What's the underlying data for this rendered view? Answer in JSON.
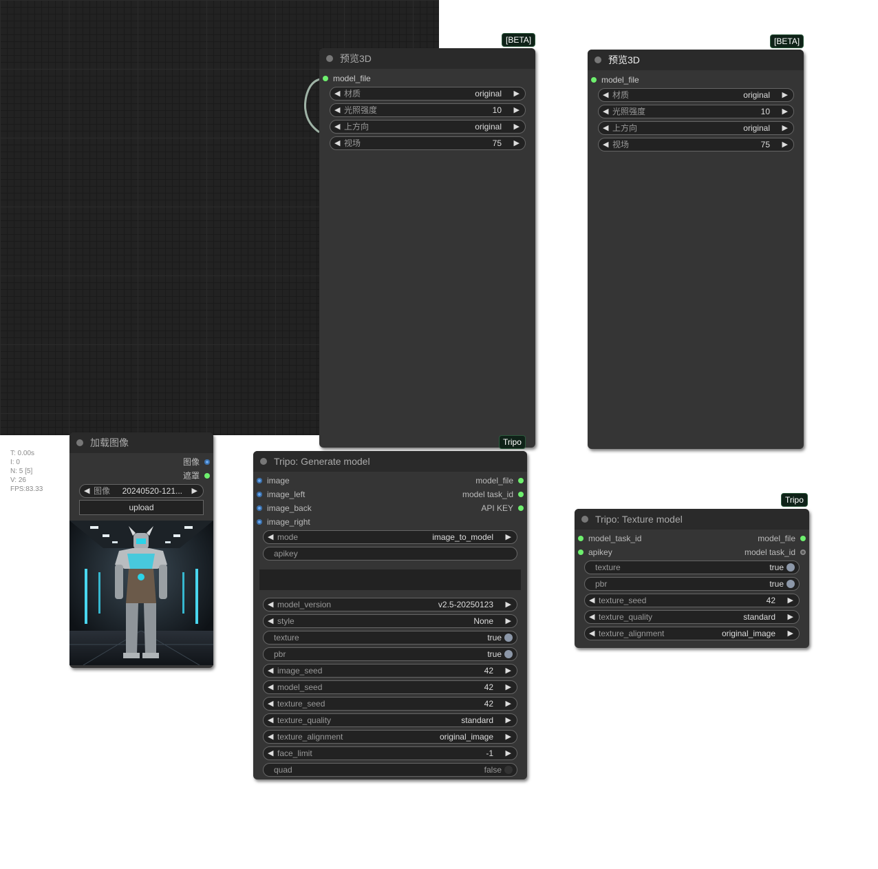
{
  "stats": {
    "t": "T: 0.00s",
    "i": "I: 0",
    "n": "N: 5 [5]",
    "v": "V: 26",
    "fps": "FPS:83.33"
  },
  "preview1": {
    "badge": "[BETA]",
    "footer_badge": "Tripo",
    "title": "预览3D",
    "input": "model_file",
    "widgets": [
      {
        "label": "材质",
        "value": "original"
      },
      {
        "label": "光照强度",
        "value": "10"
      },
      {
        "label": "上方向",
        "value": "original"
      },
      {
        "label": "视场",
        "value": "75"
      }
    ]
  },
  "preview2": {
    "badge": "[BETA]",
    "title": "预览3D",
    "input": "model_file",
    "widgets": [
      {
        "label": "材质",
        "value": "original"
      },
      {
        "label": "光照强度",
        "value": "10"
      },
      {
        "label": "上方向",
        "value": "original"
      },
      {
        "label": "视场",
        "value": "75"
      }
    ]
  },
  "loadimage": {
    "title": "加载图像",
    "out_image": "图像",
    "out_mask": "遮罩",
    "image_label": "图像",
    "image_value": "20240520-121...",
    "upload": "upload"
  },
  "generate": {
    "title": "Tripo: Generate model",
    "inputs": [
      "image",
      "image_left",
      "image_back",
      "image_right"
    ],
    "outputs": [
      "model_file",
      "model task_id",
      "API KEY"
    ],
    "mode": {
      "label": "mode",
      "value": "image_to_model"
    },
    "apikey": "apikey",
    "widgets": [
      {
        "label": "model_version",
        "value": "v2.5-20250123"
      },
      {
        "label": "style",
        "value": "None"
      }
    ],
    "texture": {
      "label": "texture",
      "value": "true"
    },
    "pbr": {
      "label": "pbr",
      "value": "true"
    },
    "widgets2": [
      {
        "label": "image_seed",
        "value": "42"
      },
      {
        "label": "model_seed",
        "value": "42"
      },
      {
        "label": "texture_seed",
        "value": "42"
      },
      {
        "label": "texture_quality",
        "value": "standard"
      },
      {
        "label": "texture_alignment",
        "value": "original_image"
      },
      {
        "label": "face_limit",
        "value": "-1"
      }
    ],
    "quad": {
      "label": "quad",
      "value": "false"
    }
  },
  "texture": {
    "badge": "Tripo",
    "title": "Tripo: Texture model",
    "inputs": [
      "model_task_id",
      "apikey"
    ],
    "outputs": [
      "model_file",
      "model task_id"
    ],
    "texture": {
      "label": "texture",
      "value": "true"
    },
    "pbr": {
      "label": "pbr",
      "value": "true"
    },
    "widgets": [
      {
        "label": "texture_seed",
        "value": "42"
      },
      {
        "label": "texture_quality",
        "value": "standard"
      },
      {
        "label": "texture_alignment",
        "value": "original_image"
      }
    ]
  },
  "colors": {
    "canvas": "#222222",
    "node_body": "#353535",
    "node_title": "#2a2a2a",
    "slot_green": "#6ef06e",
    "slot_blue": "#6aa9f2"
  }
}
